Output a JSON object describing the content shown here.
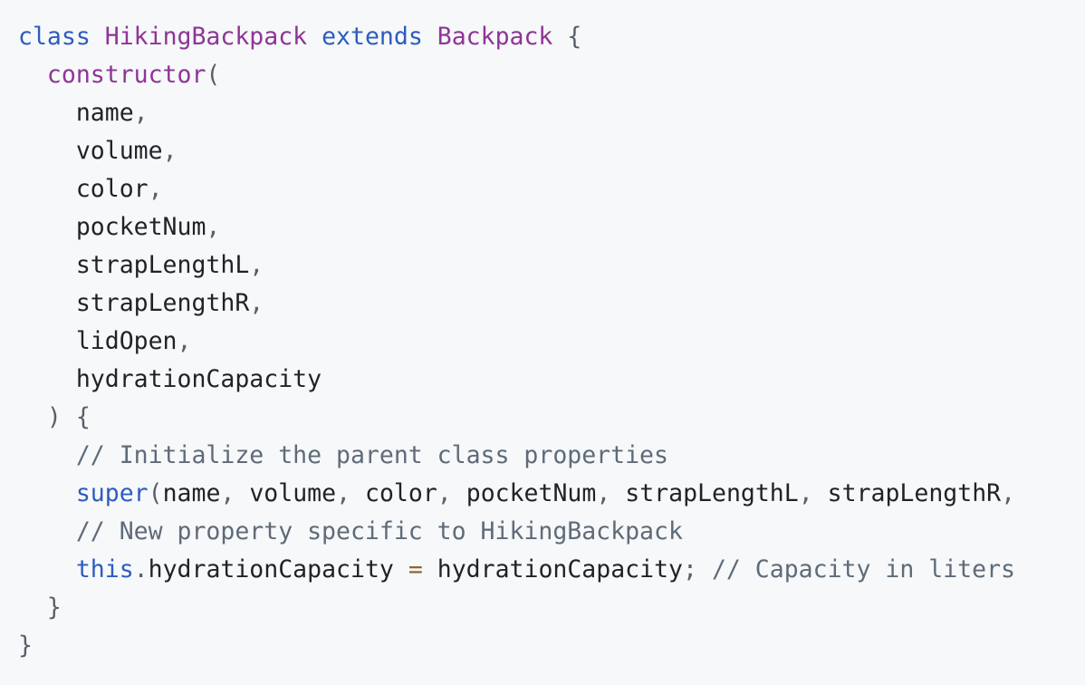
{
  "code_lines": [
    [
      {
        "type": "keyword",
        "text": "class"
      },
      {
        "type": "plain",
        "text": " "
      },
      {
        "type": "class",
        "text": "HikingBackpack"
      },
      {
        "type": "plain",
        "text": " "
      },
      {
        "type": "keyword",
        "text": "extends"
      },
      {
        "type": "plain",
        "text": " "
      },
      {
        "type": "class",
        "text": "Backpack"
      },
      {
        "type": "plain",
        "text": " "
      },
      {
        "type": "punct",
        "text": "{"
      }
    ],
    [
      {
        "type": "plain",
        "text": "  "
      },
      {
        "type": "func",
        "text": "constructor"
      },
      {
        "type": "punct",
        "text": "("
      }
    ],
    [
      {
        "type": "plain",
        "text": "    "
      },
      {
        "type": "param",
        "text": "name"
      },
      {
        "type": "punct",
        "text": ","
      }
    ],
    [
      {
        "type": "plain",
        "text": "    "
      },
      {
        "type": "param",
        "text": "volume"
      },
      {
        "type": "punct",
        "text": ","
      }
    ],
    [
      {
        "type": "plain",
        "text": "    "
      },
      {
        "type": "param",
        "text": "color"
      },
      {
        "type": "punct",
        "text": ","
      }
    ],
    [
      {
        "type": "plain",
        "text": "    "
      },
      {
        "type": "param",
        "text": "pocketNum"
      },
      {
        "type": "punct",
        "text": ","
      }
    ],
    [
      {
        "type": "plain",
        "text": "    "
      },
      {
        "type": "param",
        "text": "strapLengthL"
      },
      {
        "type": "punct",
        "text": ","
      }
    ],
    [
      {
        "type": "plain",
        "text": "    "
      },
      {
        "type": "param",
        "text": "strapLengthR"
      },
      {
        "type": "punct",
        "text": ","
      }
    ],
    [
      {
        "type": "plain",
        "text": "    "
      },
      {
        "type": "param",
        "text": "lidOpen"
      },
      {
        "type": "punct",
        "text": ","
      }
    ],
    [
      {
        "type": "plain",
        "text": "    "
      },
      {
        "type": "param",
        "text": "hydrationCapacity"
      }
    ],
    [
      {
        "type": "plain",
        "text": "  "
      },
      {
        "type": "punct",
        "text": ")"
      },
      {
        "type": "plain",
        "text": " "
      },
      {
        "type": "punct",
        "text": "{"
      }
    ],
    [
      {
        "type": "plain",
        "text": "    "
      },
      {
        "type": "comment",
        "text": "// Initialize the parent class properties"
      }
    ],
    [
      {
        "type": "plain",
        "text": "    "
      },
      {
        "type": "builtin",
        "text": "super"
      },
      {
        "type": "punct",
        "text": "("
      },
      {
        "type": "param",
        "text": "name"
      },
      {
        "type": "punct",
        "text": ","
      },
      {
        "type": "plain",
        "text": " "
      },
      {
        "type": "param",
        "text": "volume"
      },
      {
        "type": "punct",
        "text": ","
      },
      {
        "type": "plain",
        "text": " "
      },
      {
        "type": "param",
        "text": "color"
      },
      {
        "type": "punct",
        "text": ","
      },
      {
        "type": "plain",
        "text": " "
      },
      {
        "type": "param",
        "text": "pocketNum"
      },
      {
        "type": "punct",
        "text": ","
      },
      {
        "type": "plain",
        "text": " "
      },
      {
        "type": "param",
        "text": "strapLengthL"
      },
      {
        "type": "punct",
        "text": ","
      },
      {
        "type": "plain",
        "text": " "
      },
      {
        "type": "param",
        "text": "strapLengthR"
      },
      {
        "type": "punct",
        "text": ","
      }
    ],
    [
      {
        "type": "plain",
        "text": "    "
      },
      {
        "type": "comment",
        "text": "// New property specific to HikingBackpack"
      }
    ],
    [
      {
        "type": "plain",
        "text": "    "
      },
      {
        "type": "builtin",
        "text": "this"
      },
      {
        "type": "punct",
        "text": "."
      },
      {
        "type": "param",
        "text": "hydrationCapacity"
      },
      {
        "type": "plain",
        "text": " "
      },
      {
        "type": "op",
        "text": "="
      },
      {
        "type": "plain",
        "text": " "
      },
      {
        "type": "param",
        "text": "hydrationCapacity"
      },
      {
        "type": "punct",
        "text": ";"
      },
      {
        "type": "plain",
        "text": " "
      },
      {
        "type": "comment",
        "text": "// Capacity in liters"
      }
    ],
    [
      {
        "type": "plain",
        "text": "  "
      },
      {
        "type": "punct",
        "text": "}"
      }
    ],
    [
      {
        "type": "punct",
        "text": "}"
      }
    ]
  ],
  "colors": {
    "background": "#f6f8fa",
    "keyword": "#2e5cbf",
    "class": "#8e3596",
    "comment": "#5f6b78",
    "text": "#24292f"
  }
}
